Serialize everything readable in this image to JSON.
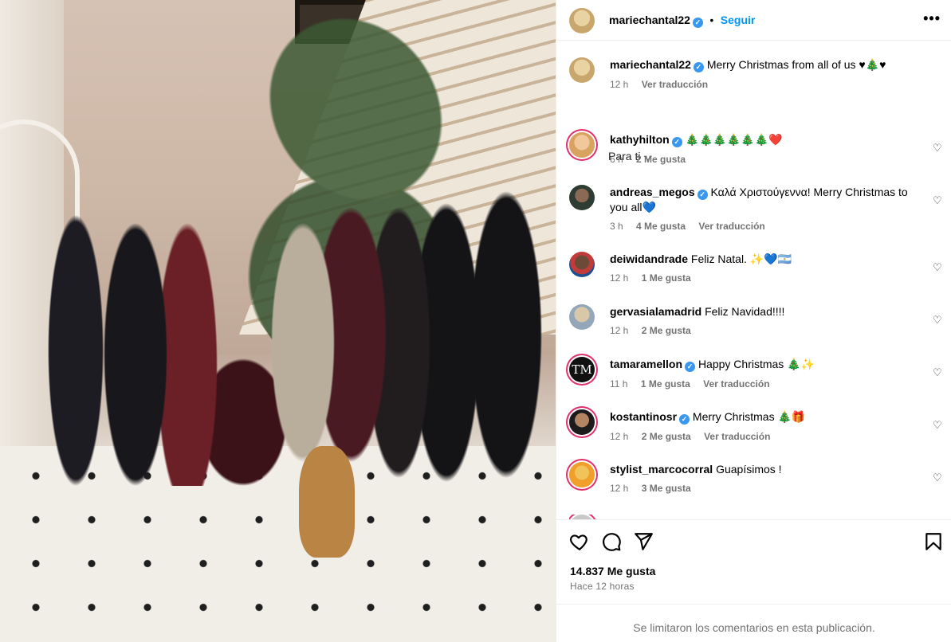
{
  "post": {
    "author": "mariechantal22",
    "follow_label": "Seguir",
    "separator": "•",
    "more_label": "•••",
    "caption": "Merry Christmas from all of us ♥🎄♥",
    "caption_time": "12 h",
    "caption_translate": "Ver traducción"
  },
  "sort": {
    "label": "Para ti ⌵"
  },
  "comments": [
    {
      "user": "kathyhilton",
      "verified": true,
      "text": "🎄🎄🎄🎄🎄🎄❤️",
      "time": "6 h",
      "likes": "2 Me gusta",
      "translate": ""
    },
    {
      "user": "andreas_megos",
      "verified": true,
      "text": "Καλά Χριστούγεννα! Merry Christmas to you all💙",
      "time": "3 h",
      "likes": "4 Me gusta",
      "translate": "Ver traducción"
    },
    {
      "user": "deiwidandrade",
      "verified": false,
      "text": "Feliz Natal. ✨💙🇦🇷",
      "time": "12 h",
      "likes": "1 Me gusta",
      "translate": ""
    },
    {
      "user": "gervasialamadrid",
      "verified": false,
      "text": "Feliz Navidad!!!!",
      "time": "12 h",
      "likes": "2 Me gusta",
      "translate": ""
    },
    {
      "user": "tamaramellon",
      "verified": true,
      "text": "Happy Christmas 🎄✨",
      "time": "11 h",
      "likes": "1 Me gusta",
      "translate": "Ver traducción"
    },
    {
      "user": "kostantinosr",
      "verified": true,
      "text": "Merry Christmas 🎄🎁",
      "time": "12 h",
      "likes": "2 Me gusta",
      "translate": "Ver traducción"
    },
    {
      "user": "stylist_marcocorral",
      "verified": false,
      "text": "Guapísimos !",
      "time": "12 h",
      "likes": "3 Me gusta",
      "translate": ""
    }
  ],
  "verified_glyph": "✓",
  "heart_glyph": "♡",
  "tamara_monogram": "TM",
  "stats": {
    "likes": "14.837 Me gusta",
    "posted": "Hace 12 horas"
  },
  "footer": {
    "limited": "Se limitaron los comentarios en esta publicación."
  },
  "icons": [
    "heart-icon",
    "comment-icon",
    "share-icon",
    "bookmark-icon",
    "more-icon",
    "verified-icon"
  ],
  "colors": {
    "accent": "#0095f6",
    "verified": "#3897f0",
    "muted": "#737373"
  }
}
